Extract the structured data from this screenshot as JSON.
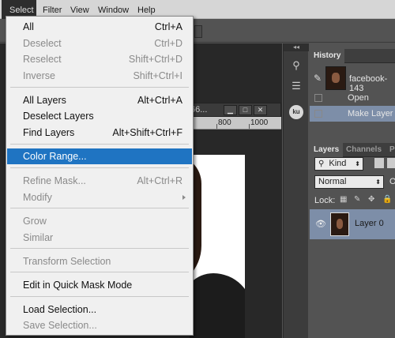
{
  "menubar": {
    "items": [
      "Select",
      "Filter",
      "View",
      "Window",
      "Help"
    ]
  },
  "document": {
    "tab_title": "66...",
    "ruler_marks": [
      "800",
      "1000"
    ]
  },
  "history_panel": {
    "tab": "History",
    "snapshot": "facebook-143",
    "states": [
      "Open",
      "Make Layer"
    ]
  },
  "layers_panel": {
    "tabs": [
      "Layers",
      "Channels",
      "P"
    ],
    "filter": "Kind",
    "blend_mode": "Normal",
    "opacity_label": "O",
    "lock_label": "Lock:",
    "layer_name": "Layer 0"
  },
  "select_menu": {
    "items": [
      {
        "label": "All",
        "shortcut": "Ctrl+A",
        "enabled": true
      },
      {
        "label": "Deselect",
        "shortcut": "Ctrl+D",
        "enabled": false
      },
      {
        "label": "Reselect",
        "shortcut": "Shift+Ctrl+D",
        "enabled": false
      },
      {
        "label": "Inverse",
        "shortcut": "Shift+Ctrl+I",
        "enabled": false
      },
      {
        "label": "All Layers",
        "shortcut": "Alt+Ctrl+A",
        "enabled": true
      },
      {
        "label": "Deselect Layers",
        "shortcut": "",
        "enabled": true
      },
      {
        "label": "Find Layers",
        "shortcut": "Alt+Shift+Ctrl+F",
        "enabled": true
      },
      {
        "label": "Color Range...",
        "shortcut": "",
        "enabled": true,
        "highlighted": true
      },
      {
        "label": "Refine Mask...",
        "shortcut": "Alt+Ctrl+R",
        "enabled": false
      },
      {
        "label": "Modify",
        "shortcut": "",
        "enabled": false,
        "submenu": true
      },
      {
        "label": "Grow",
        "shortcut": "",
        "enabled": false
      },
      {
        "label": "Similar",
        "shortcut": "",
        "enabled": false
      },
      {
        "label": "Transform Selection",
        "shortcut": "",
        "enabled": false
      },
      {
        "label": "Edit in Quick Mask Mode",
        "shortcut": "",
        "enabled": true
      },
      {
        "label": "Load Selection...",
        "shortcut": "",
        "enabled": true
      },
      {
        "label": "Save Selection...",
        "shortcut": "",
        "enabled": false
      }
    ]
  },
  "colors": {
    "highlight": "#1f74c2",
    "selected_row": "#7d8ea8",
    "menu_bg": "#f0f0f0"
  }
}
